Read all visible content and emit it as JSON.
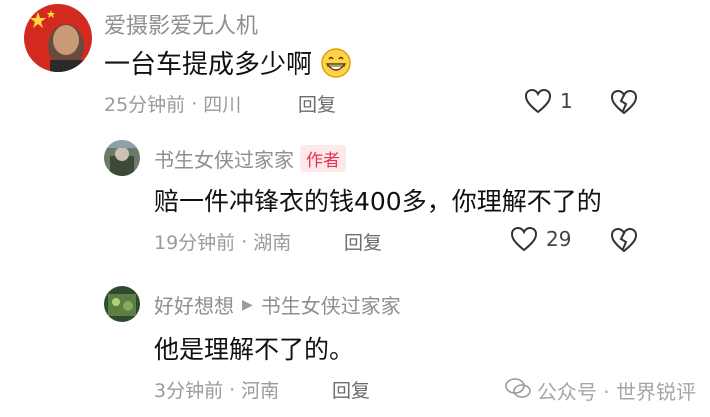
{
  "comments": [
    {
      "username": "爱摄影爱无人机",
      "text": "一台车提成多少啊",
      "emoji": "grinning-face-emoji",
      "time": "25分钟前",
      "location": "四川",
      "reply_label": "回复",
      "likes": "1"
    },
    {
      "username": "书生女侠过家家",
      "badge": "作者",
      "text": "赔一件冲锋衣的钱400多，你理解不了的",
      "time": "19分钟前",
      "location": "湖南",
      "reply_label": "回复",
      "likes": "29"
    },
    {
      "username": "好好想想",
      "reply_to": "书生女侠过家家",
      "text": "他是理解不了的。",
      "time": "3分钟前",
      "location": "河南",
      "reply_label": "回复"
    }
  ],
  "separator": "·",
  "watermark": "公众号 · 世界锐评",
  "colors": {
    "author_badge_bg": "#fde8ec",
    "author_badge_text": "#e8324f",
    "meta_text": "#9a9a9f"
  }
}
